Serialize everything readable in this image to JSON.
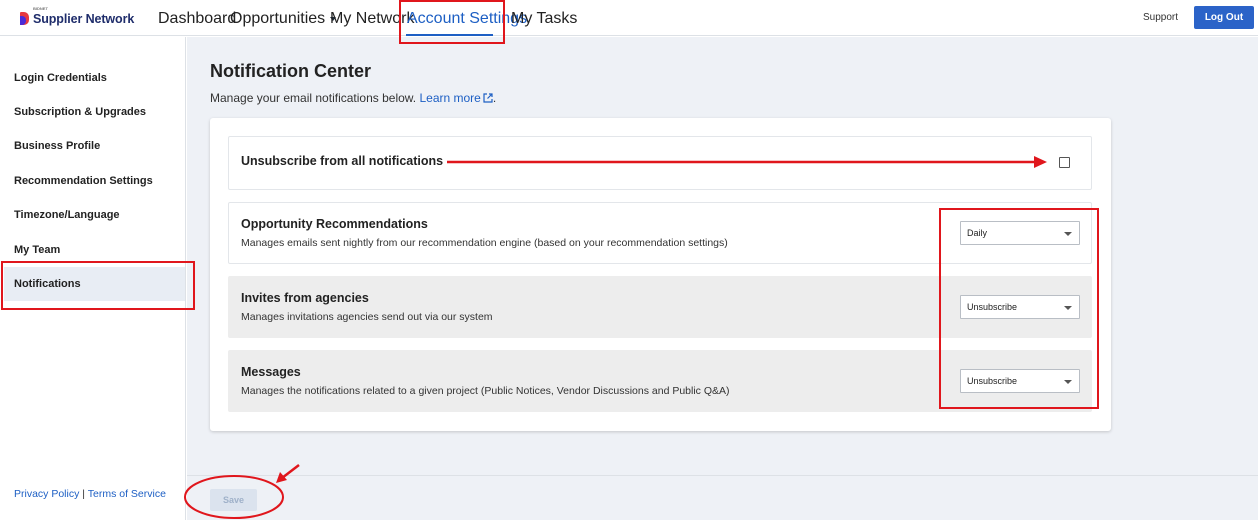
{
  "brand": {
    "name": "Supplier Network",
    "tiny": "BIDNET"
  },
  "nav": {
    "dashboard": "Dashboard",
    "opportunities": "Opportunities",
    "my_network": "My Network",
    "account_settings": "Account Settings",
    "my_tasks": "My Tasks",
    "support": "Support",
    "logout": "Log Out"
  },
  "sidebar": {
    "items": [
      {
        "label": "Login Credentials"
      },
      {
        "label": "Subscription & Upgrades"
      },
      {
        "label": "Business Profile"
      },
      {
        "label": "Recommendation Settings"
      },
      {
        "label": "Timezone/Language"
      },
      {
        "label": "My Team"
      },
      {
        "label": "Notifications",
        "active": true
      }
    ],
    "privacy": "Privacy Policy",
    "separator": "|",
    "terms": "Terms of Service"
  },
  "main": {
    "title": "Notification Center",
    "subtitle": "Manage your email notifications below.",
    "learn_more": "Learn more",
    "period": ".",
    "unsubscribe_all": {
      "label": "Unsubscribe from all notifications",
      "checked": false
    },
    "rows": [
      {
        "title": "Opportunity Recommendations",
        "desc": "Manages emails sent nightly from our recommendation engine (based on your recommendation settings)",
        "value": "Daily"
      },
      {
        "title": "Invites from agencies",
        "desc": "Manages invitations agencies send out via our system",
        "value": "Unsubscribe"
      },
      {
        "title": "Messages",
        "desc": "Manages the notifications related to a given project (Public Notices, Vendor Discussions and Public Q&A)",
        "value": "Unsubscribe"
      }
    ],
    "save": "Save"
  },
  "colors": {
    "accent": "#1d5fc4",
    "annotation": "#e0161c",
    "active_bg": "#e8edf4"
  }
}
